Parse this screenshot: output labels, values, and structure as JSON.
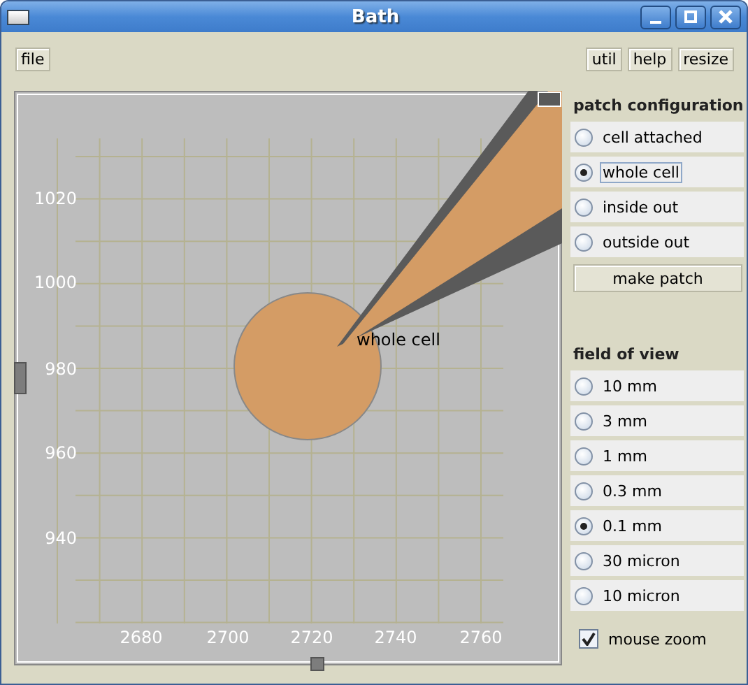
{
  "window": {
    "title": "Bath"
  },
  "toolbar": {
    "left": [
      "file"
    ],
    "right": [
      "util",
      "help",
      "resize"
    ]
  },
  "view": {
    "x_ticks": [
      "2680",
      "2700",
      "2720",
      "2740",
      "2760"
    ],
    "y_ticks": [
      "1020",
      "1000",
      "980",
      "960",
      "940"
    ],
    "cell_label": "whole cell"
  },
  "patch_configuration": {
    "title": "patch configuration",
    "options": [
      {
        "label": "cell attached",
        "selected": false
      },
      {
        "label": "whole cell",
        "selected": true
      },
      {
        "label": "inside out",
        "selected": false
      },
      {
        "label": "outside out",
        "selected": false
      }
    ],
    "button": "make patch"
  },
  "field_of_view": {
    "title": "field of view",
    "options": [
      {
        "label": "10 mm",
        "selected": false
      },
      {
        "label": "3 mm",
        "selected": false
      },
      {
        "label": "1 mm",
        "selected": false
      },
      {
        "label": "0.3 mm",
        "selected": false
      },
      {
        "label": "0.1 mm",
        "selected": true
      },
      {
        "label": "30 micron",
        "selected": false
      },
      {
        "label": "10 micron",
        "selected": false
      }
    ]
  },
  "mouse_zoom": {
    "label": "mouse zoom",
    "checked": true
  }
}
